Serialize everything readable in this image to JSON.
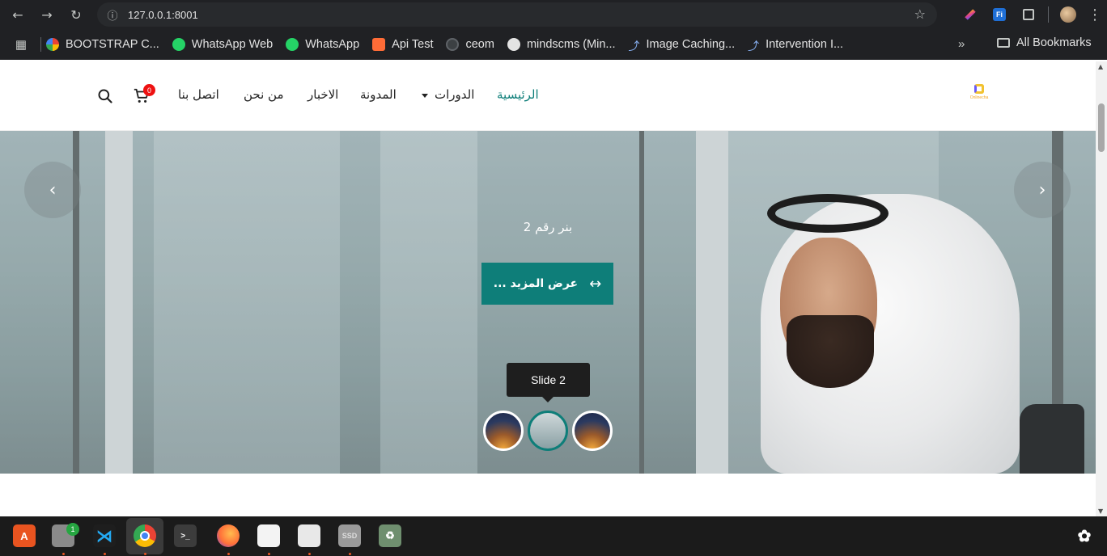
{
  "browser": {
    "url": "127.0.0.1:8001",
    "bookmarks": [
      {
        "label": "BOOTSTRAP C...",
        "icon": "google-icon"
      },
      {
        "label": "WhatsApp Web",
        "icon": "whatsapp-icon"
      },
      {
        "label": "WhatsApp",
        "icon": "whatsapp-icon"
      },
      {
        "label": "Api Test",
        "icon": "postman-icon"
      },
      {
        "label": "ceom",
        "icon": "globe-icon"
      },
      {
        "label": "mindscms (Min...",
        "icon": "github-icon"
      },
      {
        "label": "Image Caching...",
        "icon": "link-icon"
      },
      {
        "label": "Intervention I...",
        "icon": "link-icon"
      }
    ],
    "more_label": "»",
    "all_bookmarks_label": "All Bookmarks"
  },
  "site": {
    "logo_text": "Onlinecha",
    "nav": {
      "home": "الرئيسية",
      "courses": "الدورات",
      "blog": "المدونة",
      "news": "الاخبار",
      "about": "من نحن",
      "contact": "اتصل بنا"
    },
    "cart_count": "0"
  },
  "hero": {
    "caption": "بنر رقم 2",
    "cta_label": "... عرض المزيد",
    "cta_icon": "↔",
    "tooltip": "Slide 2",
    "prev_icon": "‹",
    "next_icon": "›",
    "slides": [
      "Slide 1",
      "Slide 2",
      "Slide 3"
    ],
    "active_slide": 2
  },
  "taskbar": {
    "apps": [
      "app-center-icon",
      "files-icon",
      "vscode-icon",
      "chrome-icon",
      "terminal-icon",
      "firefox-icon",
      "text-editor-icon",
      "document-viewer-icon",
      "disk-icon",
      "trash-icon"
    ],
    "files_badge": "1",
    "disk_label": "SSD"
  },
  "colors": {
    "accent": "#0e7e79",
    "badge": "#e11111"
  }
}
